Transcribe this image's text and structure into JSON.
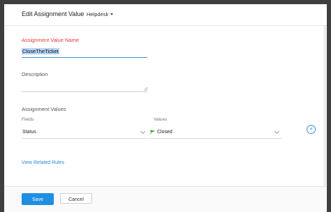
{
  "dialog": {
    "title": "Edit Assignment Value",
    "module_label": "Helpdesk"
  },
  "form": {
    "name_label": "Assignment Value Name",
    "name_value": "CloseTheTicket",
    "description_label": "Description",
    "description_value": "",
    "section_title": "Assignment Values",
    "fields_header": "Fields",
    "values_header": "Values",
    "field_selected": "Status",
    "value_selected": "Closed",
    "add_symbol": "+",
    "related_link": "View Related Rules"
  },
  "footer": {
    "save_label": "Save",
    "cancel_label": "Cancel"
  },
  "colors": {
    "accent": "#1e8fe1",
    "required_label": "#e53935",
    "flag_icon": "#43a047"
  },
  "icons": {
    "module": "chevron-down-icon",
    "field_select": "chevron-down-icon",
    "value_select": "chevron-down-icon",
    "status_value": "flag-icon",
    "add": "plus-circle-icon",
    "resize": "resize-handle-icon"
  }
}
